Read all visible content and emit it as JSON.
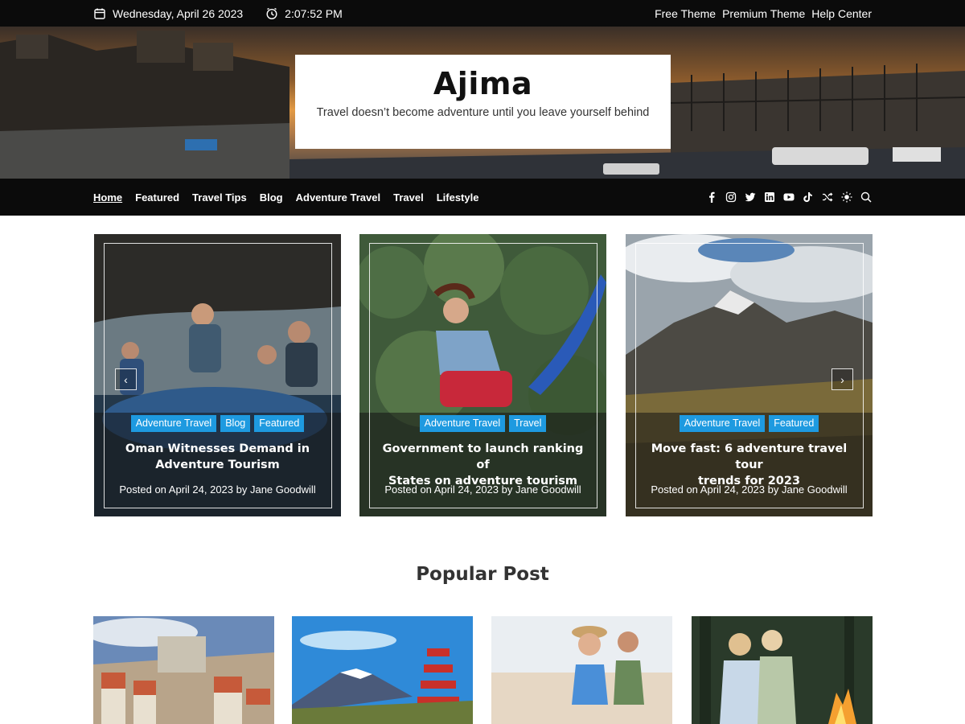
{
  "topbar": {
    "date": "Wednesday, April 26 2023",
    "time": "2:07:52 PM",
    "links": [
      "Free Theme",
      "Premium Theme",
      "Help Center"
    ]
  },
  "site": {
    "title": "Ajima",
    "tagline": "Travel doesn’t become adventure until you leave yourself behind"
  },
  "nav": {
    "items": [
      "Home",
      "Featured",
      "Travel Tips",
      "Blog",
      "Adventure Travel",
      "Travel",
      "Lifestyle"
    ],
    "active": "Home",
    "icons": [
      "facebook-icon",
      "instagram-icon",
      "twitter-icon",
      "linkedin-icon",
      "youtube-icon",
      "tiktok-icon",
      "shuffle-icon",
      "theme-toggle-icon",
      "search-icon"
    ]
  },
  "slider": {
    "cards": [
      {
        "categories": [
          "Adventure Travel",
          "Blog",
          "Featured"
        ],
        "title_line1": "Oman Witnesses Demand in",
        "title_line2": "Adventure Tourism",
        "meta": "Posted on April 24, 2023 by Jane Goodwill"
      },
      {
        "categories": [
          "Adventure Travel",
          "Travel"
        ],
        "title_line1": "Government to launch ranking of",
        "title_line2": "States on adventure tourism",
        "meta": "Posted on April 24, 2023 by Jane Goodwill"
      },
      {
        "categories": [
          "Adventure Travel",
          "Featured"
        ],
        "title_line1": "Move fast: 6 adventure travel tour",
        "title_line2": "trends for 2023",
        "meta": "Posted on April 24, 2023 by Jane Goodwill"
      }
    ],
    "prev_label": "‹",
    "next_label": "›"
  },
  "popular": {
    "heading": "Popular Post"
  },
  "colors": {
    "accent": "#1e9ae0",
    "bar": "#0b0b0b"
  }
}
